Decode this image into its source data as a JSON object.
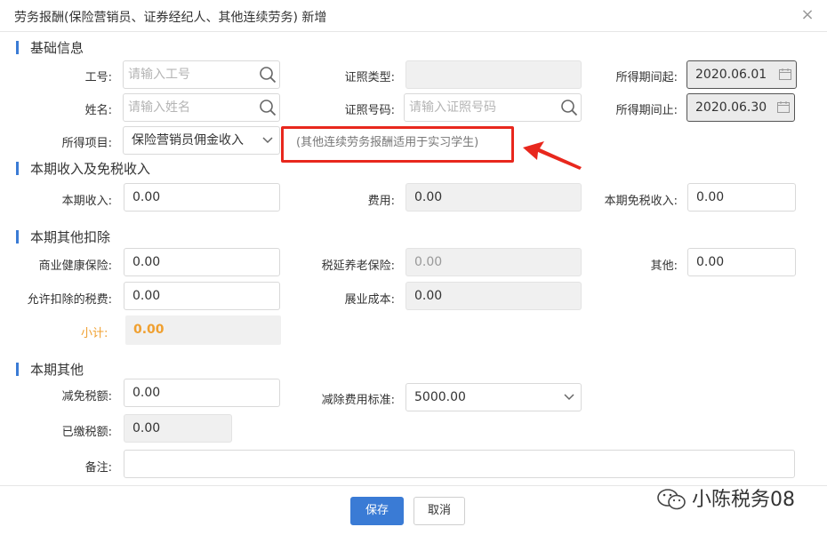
{
  "dialog": {
    "title": "劳务报酬(保险营销员、证券经纪人、其他连续劳务) 新增",
    "close_glyph": "×"
  },
  "sections": {
    "basic": "基础信息",
    "income": "本期收入及免税收入",
    "deductions": "本期其他扣除",
    "other": "本期其他"
  },
  "basic": {
    "emp_no_label": "工号:",
    "emp_no_placeholder": "请输入工号",
    "id_type_label": "证照类型:",
    "id_type_value": "",
    "period_start_label": "所得期间起:",
    "period_start_value": "2020.06.01",
    "name_label": "姓名:",
    "name_placeholder": "请输入姓名",
    "id_no_label": "证照号码:",
    "id_no_placeholder": "请输入证照号码",
    "period_end_label": "所得期间止:",
    "period_end_value": "2020.06.30",
    "item_label": "所得项目:",
    "item_value": "保险营销员佣金收入",
    "note": "(其他连续劳务报酬适用于实习学生)"
  },
  "income": {
    "income_label": "本期收入:",
    "income_value": "0.00",
    "expense_label": "费用:",
    "expense_value": "0.00",
    "tax_free_label": "本期免税收入:",
    "tax_free_value": "0.00"
  },
  "deductions": {
    "health_label": "商业健康保险:",
    "health_value": "0.00",
    "pension_label": "税延养老保险:",
    "pension_value": "0.00",
    "other_label": "其他:",
    "other_value": "0.00",
    "allowed_tax_label": "允许扣除的税费:",
    "allowed_tax_value": "0.00",
    "biz_cost_label": "展业成本:",
    "biz_cost_value": "0.00",
    "subtotal_label": "小计:",
    "subtotal_value": "0.00"
  },
  "other": {
    "reduction_label": "减免税额:",
    "reduction_value": "0.00",
    "standard_label": "减除费用标准:",
    "standard_value": "5000.00",
    "paid_label": "已缴税额:",
    "paid_value": "0.00",
    "remark_label": "备注:",
    "remark_value": ""
  },
  "footer": {
    "save": "保存",
    "cancel": "取消"
  },
  "watermark": "小陈税务08",
  "colors": {
    "accent": "#3a7bd5",
    "annotation": "#e8271d",
    "subtotal": "#f0a030"
  },
  "icons": [
    "search-icon",
    "calendar-icon",
    "chevron-down-icon",
    "close-icon",
    "wechat-icon",
    "arrow-annotation"
  ]
}
